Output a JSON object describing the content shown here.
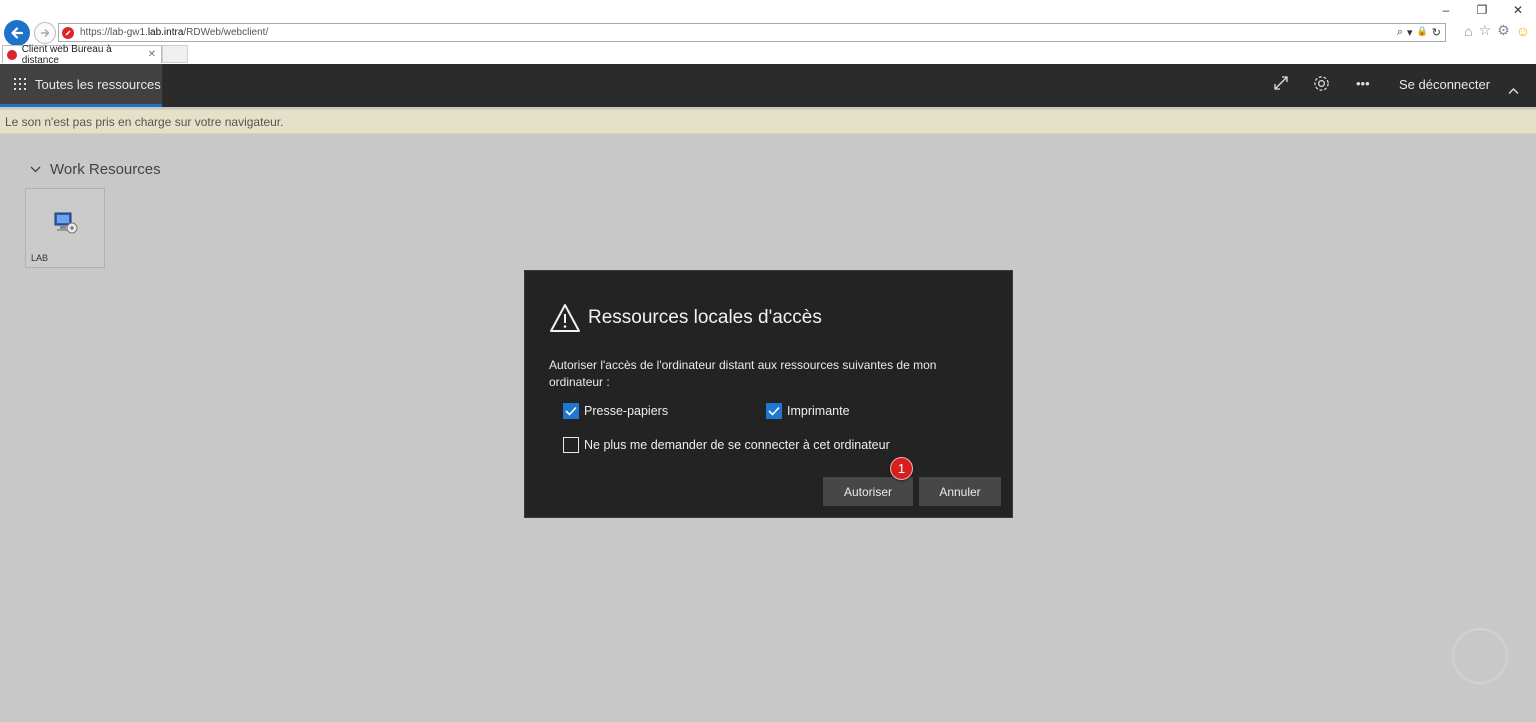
{
  "browser": {
    "url_prefix": "https://lab-gw1.",
    "url_domain": "lab.intra",
    "url_path": "/RDWeb/webclient/",
    "tab_title": "Client web Bureau à distance",
    "tab_close": "✕",
    "addr_tools": [
      "⌕",
      "▾",
      "🔒",
      "↻"
    ],
    "window_controls": [
      "–",
      "❐",
      "✕"
    ]
  },
  "appbar": {
    "all_resources_label": "Toutes les ressources",
    "signout_label": "Se déconnecter",
    "more_label": "•••"
  },
  "notice": {
    "text": "Le son n'est pas pris en charge sur votre navigateur."
  },
  "resources": {
    "group_title": "Work Resources",
    "tiles": [
      {
        "label": "LAB"
      }
    ]
  },
  "dialog": {
    "title": "Ressources locales d'accès",
    "description": "Autoriser l'accès de l'ordinateur distant aux ressources suivantes de mon ordinateur :",
    "checkboxes": [
      {
        "label": "Presse-papiers",
        "checked": true
      },
      {
        "label": "Imprimante",
        "checked": true
      },
      {
        "label": "Ne plus me demander de se connecter à cet ordinateur",
        "checked": false
      }
    ],
    "allow_label": "Autoriser",
    "cancel_label": "Annuler",
    "annotation_number": "1"
  },
  "colors": {
    "accent": "#1e72c9",
    "appbar": "#2b2b2b",
    "dialog_bg": "#232323",
    "notice_bg": "#e5e1c9",
    "badge": "#d62020"
  }
}
